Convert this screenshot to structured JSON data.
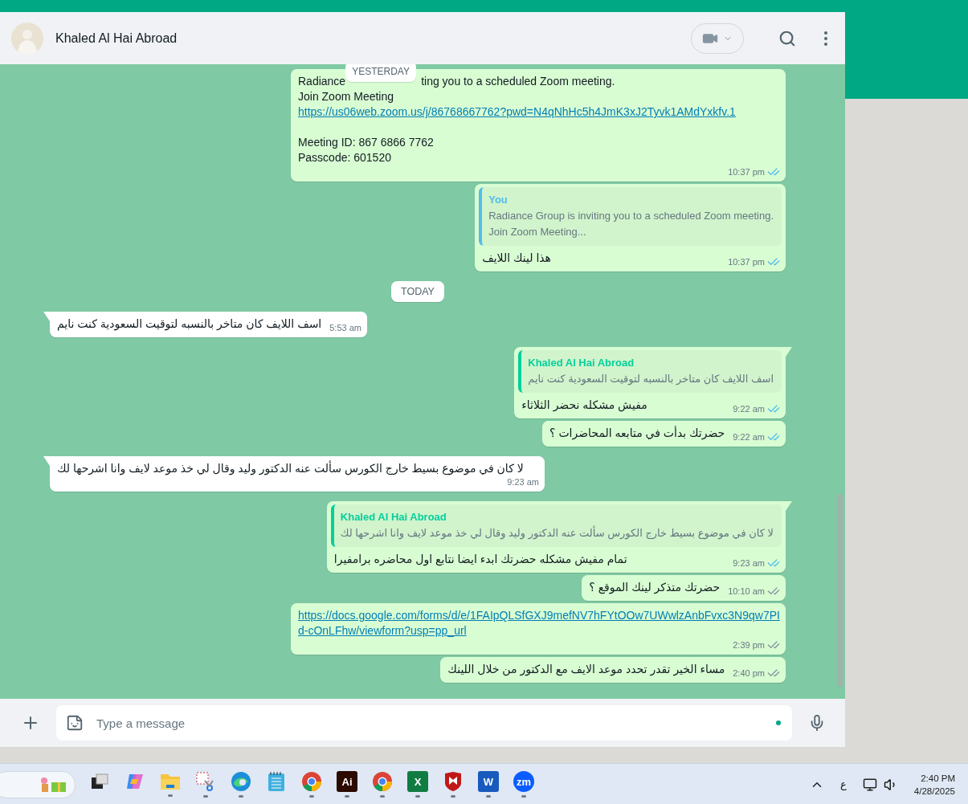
{
  "contact": {
    "name": "Khaled Al Hai Abroad"
  },
  "sticky_date": "YESTERDAY",
  "messages": [
    {
      "kind": "outgoing",
      "first_in_group": false,
      "lines": [
        {
          "kind": "covered",
          "parts": [
            "Radiance",
            "ting you to a scheduled Zoom meeting."
          ]
        },
        {
          "kind": "text",
          "text": "Join Zoom Meeting"
        },
        {
          "kind": "link",
          "text": "https://us06web.zoom.us/j/86768667762?pwd=N4qNhHc5h4JmK3xJ2Tyvk1AMdYxkfv.1"
        },
        {
          "kind": "spacer"
        },
        {
          "kind": "text",
          "text": "Meeting ID: 867 6866 7762"
        },
        {
          "kind": "text",
          "text": "Passcode: 601520"
        }
      ],
      "time": "10:37 pm",
      "read": true
    },
    {
      "kind": "outgoing",
      "first_in_group": false,
      "quote": {
        "author": "You",
        "color": "#53bdeb",
        "lines": [
          "Radiance Group is inviting you to a scheduled Zoom meeting.",
          "Join Zoom Meeting..."
        ]
      },
      "lines": [
        {
          "kind": "text",
          "text": "هذا لينك اللايف"
        }
      ],
      "time": "10:37 pm",
      "read": true
    },
    {
      "kind": "date",
      "label": "TODAY"
    },
    {
      "kind": "incoming",
      "first_in_group": true,
      "lines": [
        {
          "kind": "text",
          "text": "اسف اللايف كان متاخر بالنسبه لتوقيت السعودية كنت نايم"
        }
      ],
      "time": "5:53 am"
    },
    {
      "kind": "outgoing",
      "first_in_group": true,
      "quote": {
        "author": "Khaled Al Hai Abroad",
        "color": "#06cf9c",
        "lines": [
          "اسف اللايف كان متاخر بالنسبه لتوقيت السعودية كنت نايم"
        ]
      },
      "lines": [
        {
          "kind": "text",
          "text": "مفيش مشكله نحضر الثلاثاء"
        }
      ],
      "time": "9:22 am",
      "read": true
    },
    {
      "kind": "outgoing",
      "first_in_group": false,
      "lines": [
        {
          "kind": "text",
          "text": "حضرتك بدأت في متابعه المحاضرات ؟"
        }
      ],
      "time": "9:22 am",
      "read": true
    },
    {
      "kind": "incoming",
      "first_in_group": true,
      "lines": [
        {
          "kind": "text",
          "text": "لا كان في موضوع بسيط خارج الكورس سألت عنه الدكتور وليد وقال لي خذ موعد لايف وانا اشرحها لك"
        }
      ],
      "time": "9:23 am"
    },
    {
      "kind": "outgoing",
      "first_in_group": true,
      "quote": {
        "author": "Khaled Al Hai Abroad",
        "color": "#06cf9c",
        "lines": [
          "لا كان في موضوع بسيط خارج الكورس سألت عنه الدكتور وليد وقال لي خذ موعد لايف وانا اشرحها لك"
        ]
      },
      "lines": [
        {
          "kind": "text",
          "text": "تمام مفيش مشكله حضرتك ابدء ايضا نتابع اول محاضره برامفيرا"
        }
      ],
      "time": "9:23 am",
      "read": true
    },
    {
      "kind": "outgoing",
      "first_in_group": false,
      "lines": [
        {
          "kind": "text",
          "text": "حضرتك متذكر لينك الموقع ؟"
        }
      ],
      "time": "10:10 am",
      "read": false
    },
    {
      "kind": "outgoing",
      "first_in_group": false,
      "lines": [
        {
          "kind": "link",
          "text": "https://docs.google.com/forms/d/e/1FAIpQLSfGXJ9mefNV7hFYtOOw7UWwlzAnbFvxc3N9qw7PId-cOnLFhw/viewform?usp=pp_url"
        }
      ],
      "time": "2:39 pm",
      "read": false
    },
    {
      "kind": "outgoing",
      "first_in_group": false,
      "lines": [
        {
          "kind": "text",
          "text": "مساء الخير تقدر تحدد موعد الايف مع الدكتور من خلال اللينك"
        }
      ],
      "time": "2:40 pm",
      "read": false
    }
  ],
  "composer": {
    "placeholder": "Type a message"
  },
  "taskbar": {
    "apps": [
      {
        "kind": "taskview",
        "running": false
      },
      {
        "kind": "copilot",
        "running": false
      },
      {
        "kind": "folder",
        "running": true
      },
      {
        "kind": "snip",
        "running": true
      },
      {
        "kind": "edge",
        "running": true
      },
      {
        "kind": "notepad",
        "running": false
      },
      {
        "kind": "chrome",
        "running": true
      },
      {
        "kind": "tile",
        "label": "Ai",
        "color": "#2b0a00",
        "running": true
      },
      {
        "kind": "chrome",
        "running": true
      },
      {
        "kind": "tile",
        "label": "X",
        "color": "#107c41",
        "running": true
      },
      {
        "kind": "shield",
        "running": true
      },
      {
        "kind": "tile",
        "label": "W",
        "color": "#185abd",
        "running": true
      },
      {
        "kind": "round",
        "label": "zm",
        "color": "#0b5cff",
        "running": true
      }
    ],
    "language": "ع",
    "time": "2:40 PM",
    "date": "4/28/2025"
  }
}
